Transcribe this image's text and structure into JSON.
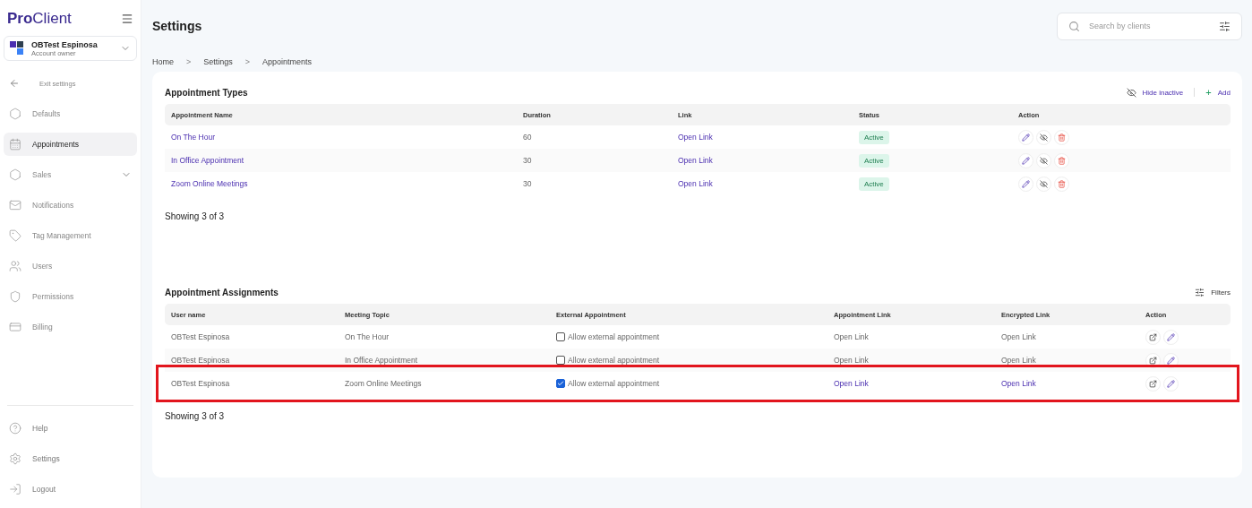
{
  "brand": {
    "name_bold": "Pro",
    "name_rest": "Client"
  },
  "account": {
    "name": "OBTest Espinosa",
    "role": "Account owner"
  },
  "exit_label": "Exit settings",
  "nav": [
    {
      "label": "Defaults",
      "selected": false,
      "expandable": false
    },
    {
      "label": "Appointments",
      "selected": true,
      "expandable": false
    },
    {
      "label": "Sales",
      "selected": false,
      "expandable": true
    },
    {
      "label": "Notifications",
      "selected": false,
      "expandable": false
    },
    {
      "label": "Tag Management",
      "selected": false,
      "expandable": false
    },
    {
      "label": "Users",
      "selected": false,
      "expandable": false
    },
    {
      "label": "Permissions",
      "selected": false,
      "expandable": false
    },
    {
      "label": "Billing",
      "selected": false,
      "expandable": false
    }
  ],
  "bottom_nav": [
    {
      "label": "Help"
    },
    {
      "label": "Settings"
    },
    {
      "label": "Logout"
    }
  ],
  "page_title": "Settings",
  "search": {
    "placeholder": "Search by clients"
  },
  "breadcrumb": [
    "Home",
    "Settings",
    "Appointments"
  ],
  "breadcrumb_separator": ">",
  "types": {
    "title": "Appointment Types",
    "hide_inactive": "Hide inactive",
    "add": "Add",
    "add_symbol": "+",
    "columns": [
      "Appointment Name",
      "Duration",
      "Link",
      "Status",
      "Action"
    ],
    "rows": [
      {
        "name": "On The Hour",
        "duration": "60",
        "link": "Open Link",
        "status": "Active"
      },
      {
        "name": "In Office Appointment",
        "duration": "30",
        "link": "Open Link",
        "status": "Active"
      },
      {
        "name": "Zoom Online Meetings",
        "duration": "30",
        "link": "Open Link",
        "status": "Active"
      }
    ],
    "footer": "Showing 3 of 3"
  },
  "assignments": {
    "title": "Appointment Assignments",
    "filters": "Filters",
    "columns": [
      "User name",
      "Meeting Topic",
      "External Appointment",
      "Appointment Link",
      "Encrypted Link",
      "Action"
    ],
    "rows": [
      {
        "user": "OBTest Espinosa",
        "topic": "On The Hour",
        "external_label": "Allow external appointment",
        "checked": false,
        "appointment_link": "Open Link",
        "encrypted_link": "Open Link",
        "highlighted": false
      },
      {
        "user": "OBTest Espinosa",
        "topic": "In Office Appointment",
        "external_label": "Allow external appointment",
        "checked": false,
        "appointment_link": "Open Link",
        "encrypted_link": "Open Link",
        "highlighted": false
      },
      {
        "user": "OBTest Espinosa",
        "topic": "Zoom Online Meetings",
        "external_label": "Allow external appointment",
        "checked": true,
        "appointment_link": "Open Link",
        "encrypted_link": "Open Link",
        "highlighted": true
      }
    ],
    "footer": "Showing 3 of 3"
  }
}
